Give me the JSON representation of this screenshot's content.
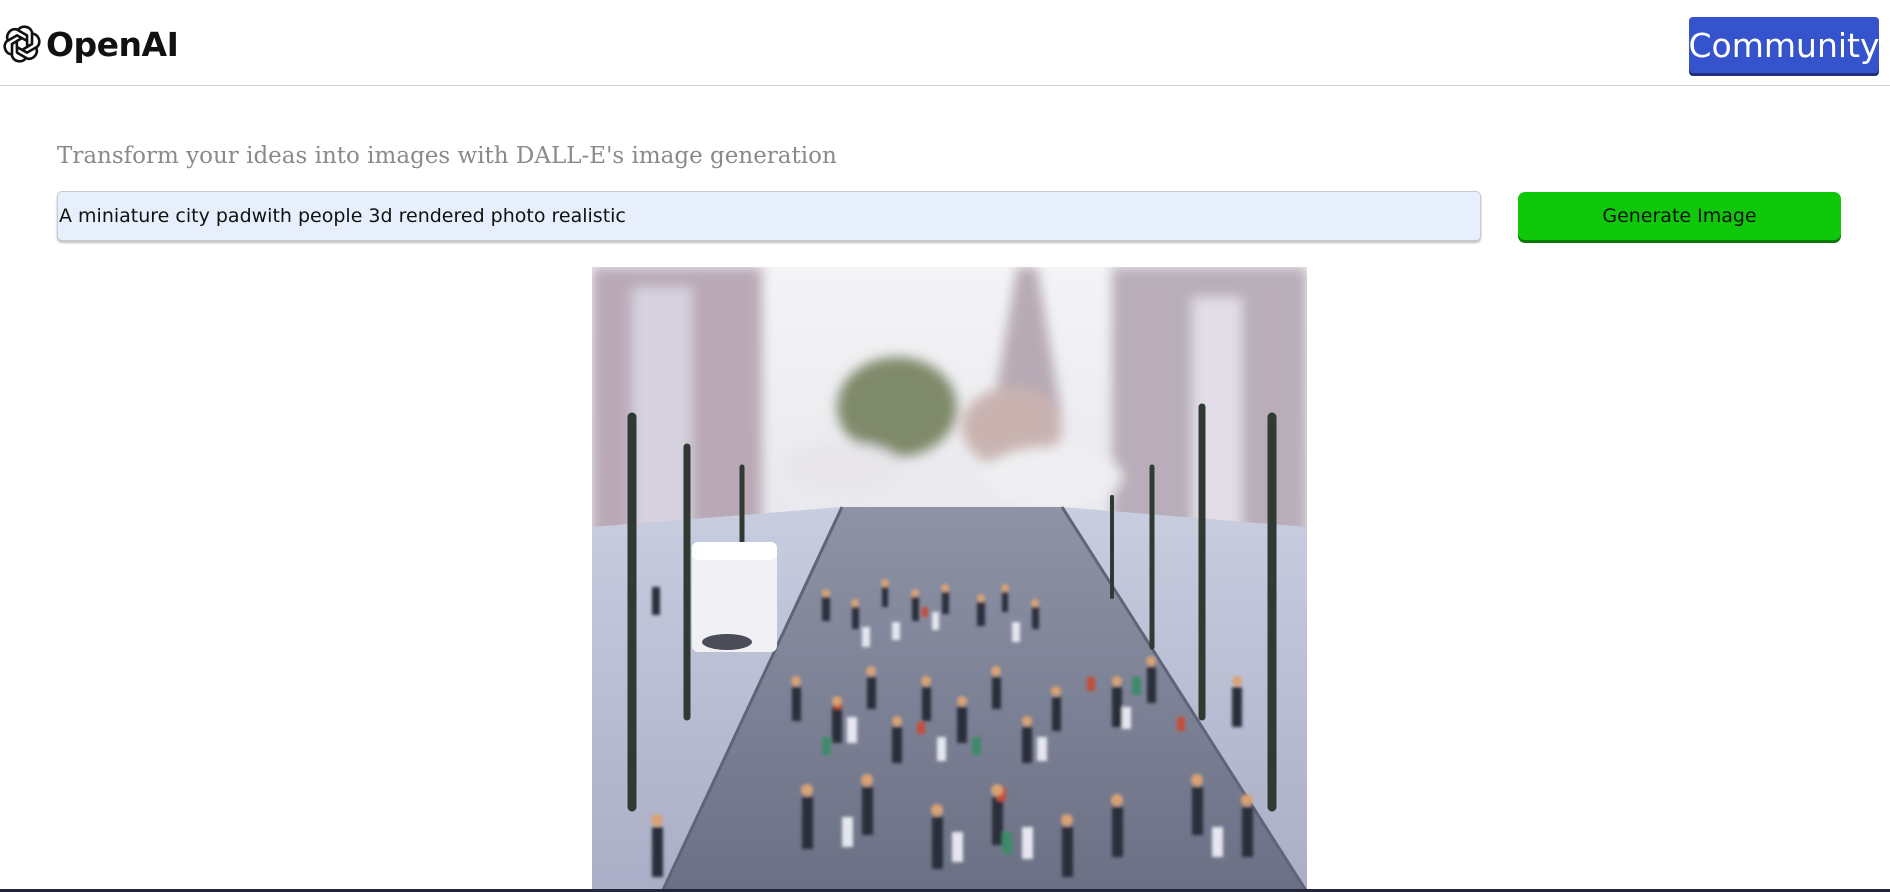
{
  "header": {
    "brand": "OpenAI",
    "logo_icon": "openai-knot-icon",
    "community_label": "Community",
    "community_color": "#3553cc"
  },
  "main": {
    "subtitle": "Transform your ideas into images with DALL-E's image generation",
    "prompt_value": "A miniature city padwith people 3d rendered photo realistic",
    "generate_label": "Generate Image",
    "generate_color": "#10c80a"
  },
  "result": {
    "image_icon": "generated-image"
  }
}
